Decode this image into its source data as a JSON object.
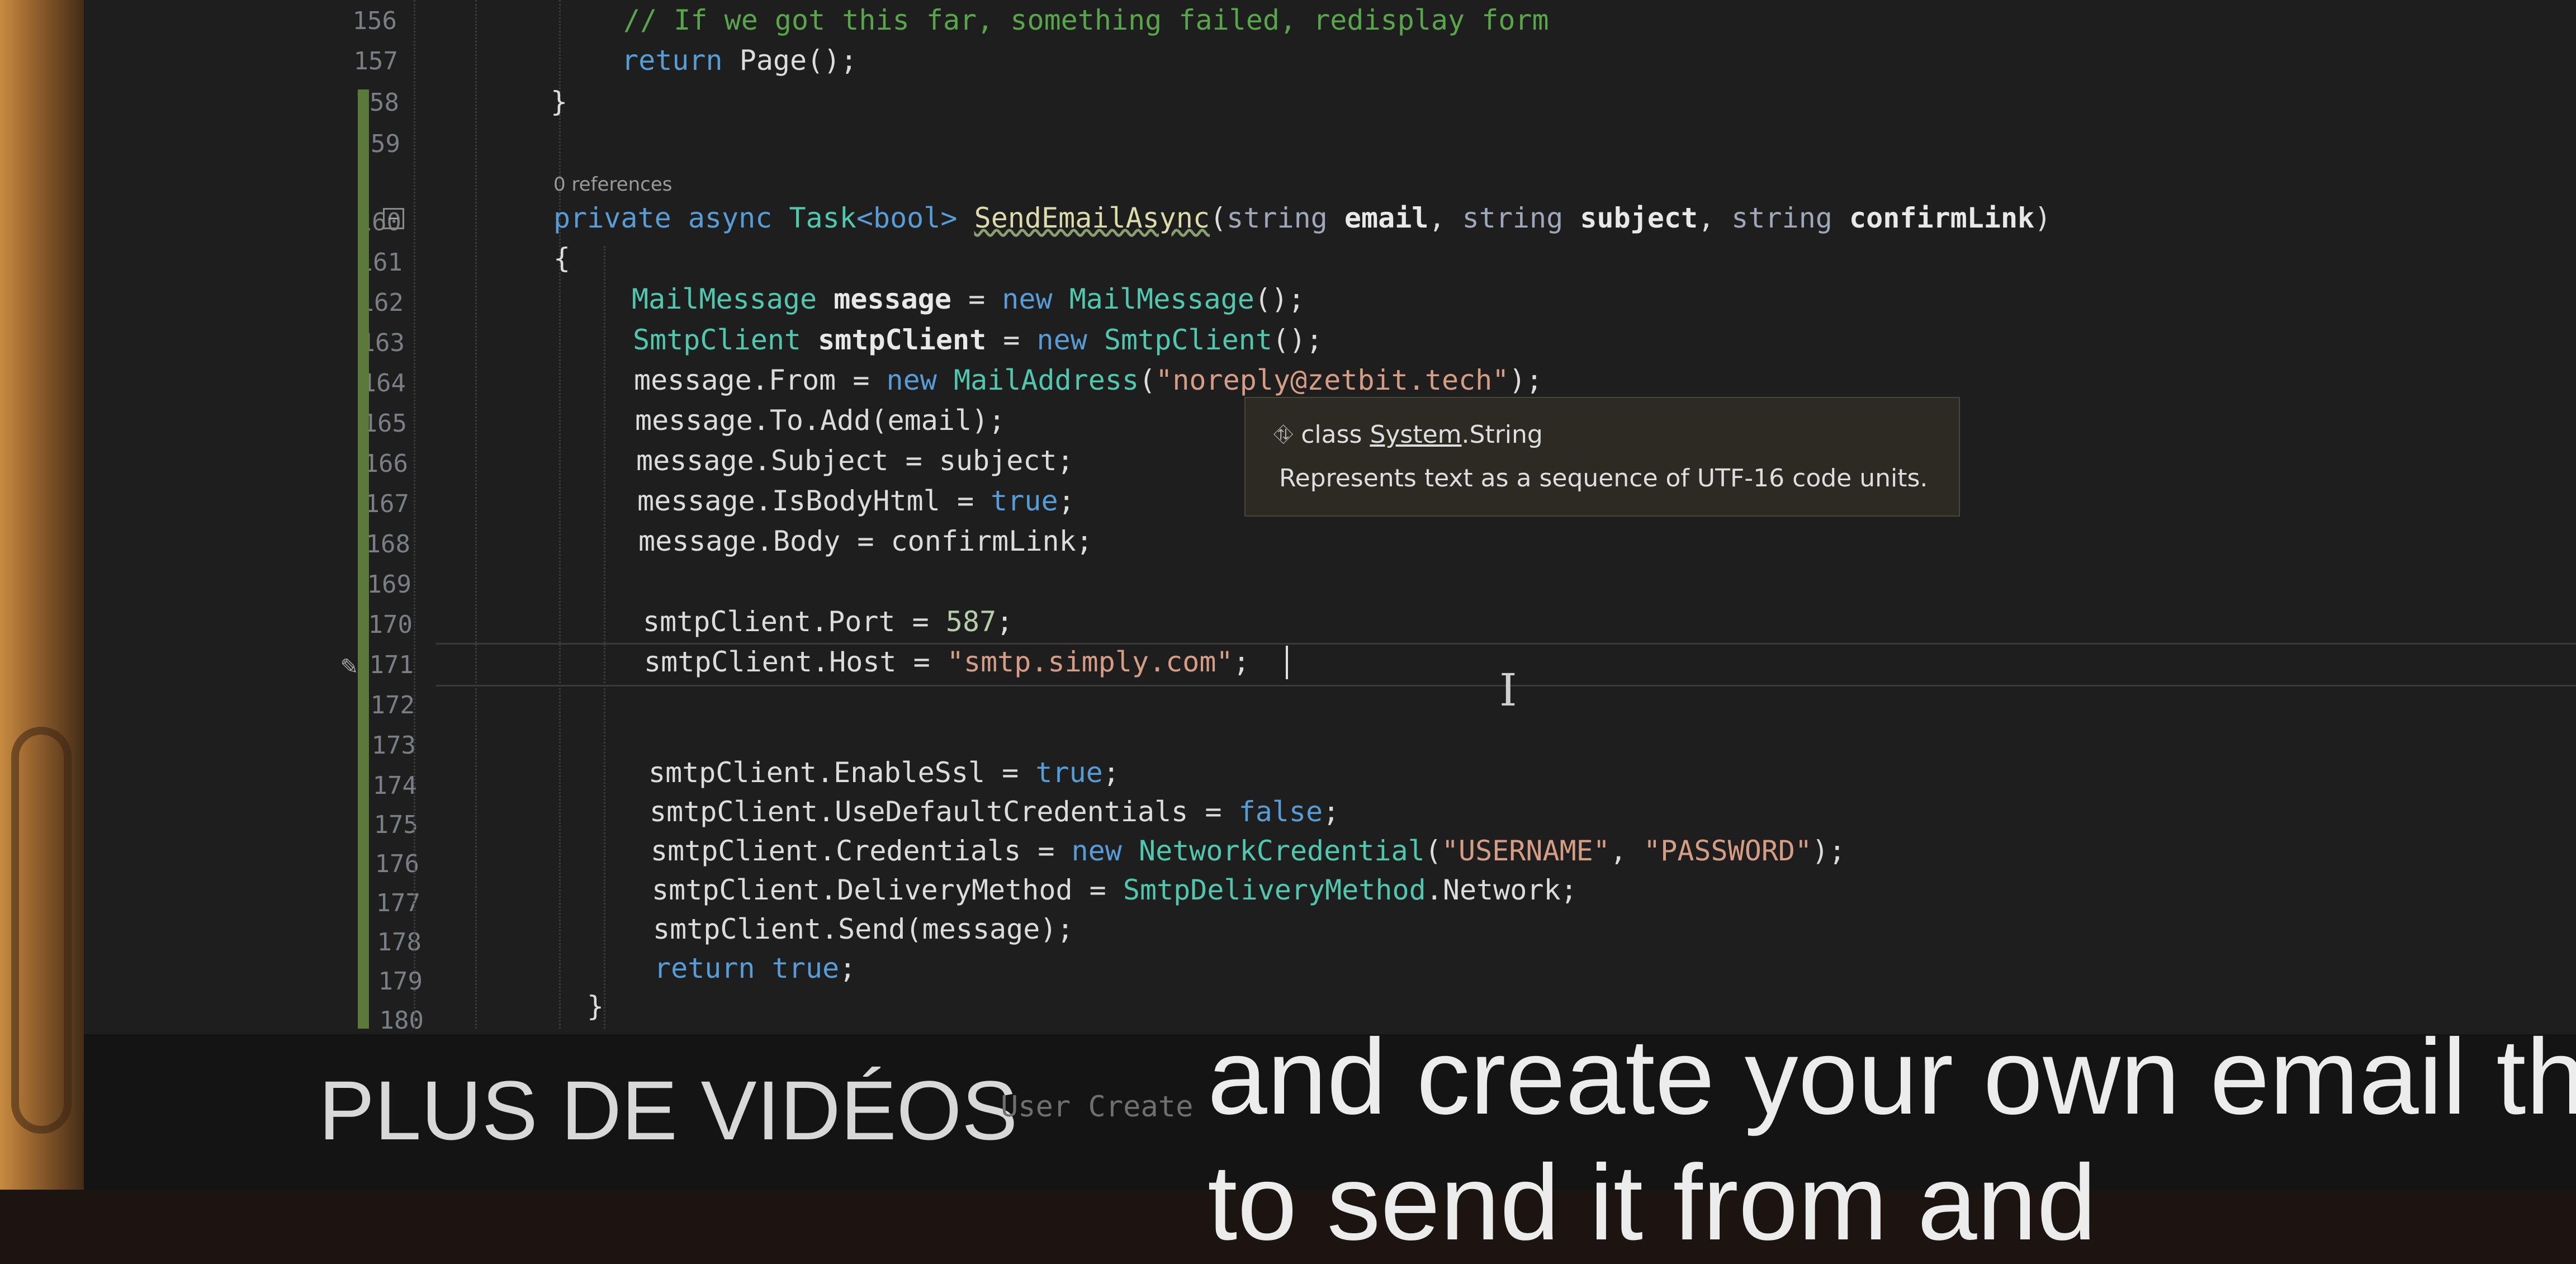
{
  "line_numbers": [
    "156",
    "157",
    "158",
    "159",
    "160",
    "161",
    "162",
    "163",
    "164",
    "165",
    "166",
    "167",
    "168",
    "169",
    "170",
    "171",
    "172",
    "173",
    "174",
    "175",
    "176",
    "177",
    "178",
    "179",
    "180"
  ],
  "codelens": "0 references",
  "code": {
    "l156": "// If we got this far, something failed, redisplay form",
    "l157_kw": "return",
    "l157_rest": " Page();",
    "l158": "}",
    "l160_private": "private",
    "l160_async": "async",
    "l160_task": "Task",
    "l160_bool": "<bool>",
    "l160_name": "SendEmailAsync",
    "l160_open": "(",
    "l160_string1": "string",
    "l160_p1": "email",
    "l160_comma1": ",",
    "l160_string2": "string",
    "l160_p2": "subject",
    "l160_comma2": ",",
    "l160_string3": "string",
    "l160_p3": "confirmLink",
    "l160_close": ")",
    "l161": "{",
    "l162_type": "MailMessage",
    "l162_var": "message",
    "l162_eq": " = ",
    "l162_new": "new",
    "l162_type2": "MailMessage",
    "l162_end": "();",
    "l163_type": "SmtpClient",
    "l163_var": "smtpClient",
    "l163_eq": " = ",
    "l163_new": "new",
    "l163_type2": "SmtpClient",
    "l163_end": "();",
    "l164_a": "message.From = ",
    "l164_new": "new",
    "l164_type": "MailAddress",
    "l164_open": "(",
    "l164_str": "\"noreply@zetbit.tech\"",
    "l164_end": ");",
    "l165": "message.To.Add(email);",
    "l166": "message.Subject = subject;",
    "l167_a": "message.IsBodyHtml = ",
    "l167_true": "true",
    "l167_end": ";",
    "l168": "message.Body = confirmLink;",
    "l170_a": "smtpClient.Port = ",
    "l170_num": "587",
    "l170_end": ";",
    "l171_a": "smtpClient.Host = ",
    "l171_str": "\"smtp.simply.com\"",
    "l171_end": ";",
    "l174_a": "smtpClient.EnableSsl = ",
    "l174_true": "true",
    "l174_end": ";",
    "l175_a": "smtpClient.UseDefaultCredentials = ",
    "l175_false": "false",
    "l175_end": ";",
    "l176_a": "smtpClient.Credentials = ",
    "l176_new": "new",
    "l176_type": "NetworkCredential",
    "l176_open": "(",
    "l176_s1": "\"USERNAME\"",
    "l176_comma": ", ",
    "l176_s2": "\"PASSWORD\"",
    "l176_end": ");",
    "l177_a": "smtpClient.DeliveryMethod = ",
    "l177_type": "SmtpDeliveryMethod",
    "l177_end": ".Network;",
    "l178": "smtpClient.Send(message);",
    "l179_kw": "return",
    "l179_true": "true",
    "l179_end": ";",
    "l180": "}"
  },
  "tooltip": {
    "kind": "class",
    "namespace": "System",
    "dot": ".",
    "name": "String",
    "description": "Represents text as a sequence of UTF-16 code units."
  },
  "overlay": {
    "more_videos": "PLUS DE VIDÉOS",
    "behind_text": "User Create",
    "caption_line1": "and create your own email th",
    "caption_line2": "to send it from and"
  },
  "colors": {
    "editor_bg": "#1e1e1e",
    "comment": "#57a64a",
    "keyword": "#569cd6",
    "type": "#4ec9b0",
    "string": "#d69d85",
    "change_bar": "#5b7a3a"
  }
}
